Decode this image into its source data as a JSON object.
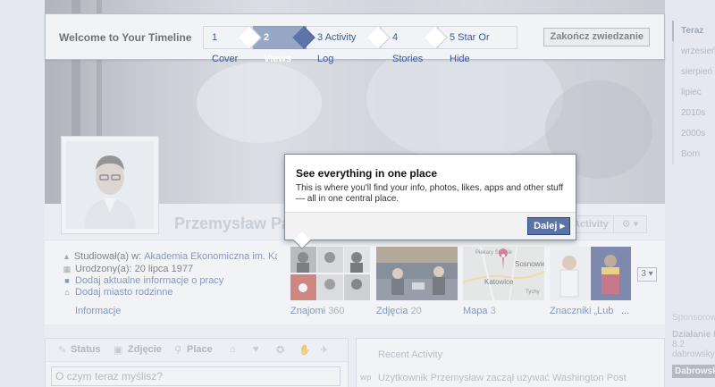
{
  "tour": {
    "title": "Welcome to Your Timeline",
    "steps": [
      {
        "label": "1 Cover",
        "active": false
      },
      {
        "label": "2 Views",
        "active": true
      },
      {
        "label": "3 Activity Log",
        "active": false
      },
      {
        "label": "4 Stories",
        "active": false
      },
      {
        "label": "5 Star Or Hide",
        "active": false
      }
    ],
    "end_label": "Zakończ zwiedzanie"
  },
  "timeline_nav": [
    "Teraz",
    "wrzesień",
    "sierpień",
    "lipiec",
    "2010s",
    "2000s",
    "Born"
  ],
  "profile": {
    "name": "Przemysław Pa",
    "activity_label": "Activity",
    "gear_label": "⚙ ▾"
  },
  "info": {
    "studied_label": "Studiował(a) w:",
    "studied_value": "Akademia Ekonomiczna im. Karol...",
    "born_label": "Urodzony(a): 20 lipca 1977",
    "add_work": "Dodaj aktualne informacje o pracy",
    "add_hometown": "Dodaj miasto rodzinne",
    "info_link": "Informacje"
  },
  "tiles": {
    "friends": {
      "label": "Znajomi",
      "count": "360"
    },
    "photos": {
      "label": "Zdjęcia",
      "count": "20"
    },
    "map": {
      "label": "Mapa",
      "count": "3",
      "places": [
        "Piekary Śląskie",
        "Sosnowiec",
        "Katowice",
        "Tychy"
      ]
    },
    "likes": {
      "label": "Znaczniki „Lub",
      "more": "..."
    },
    "more_button": "3 ▾"
  },
  "tooltip": {
    "title": "See everything in one place",
    "body": "This is where you'll find your info, photos, likes, apps and other stuff — all in one central place.",
    "next": "Dalej ▸"
  },
  "composer": {
    "status": "Status",
    "photo": "Zdjęcie",
    "place": "Place",
    "placeholder": "O czym teraz myślisz?"
  },
  "recent": {
    "title": "Recent Activity",
    "item": "Użytkownik Przemysław zaczął używać Washington Post",
    "logo": "wp"
  },
  "sponsored": {
    "title": "Sponsorowane",
    "line1": "Działanie B",
    "line2": "8.2",
    "line3": "dabrowsky",
    "ad": "Dabrowski"
  }
}
